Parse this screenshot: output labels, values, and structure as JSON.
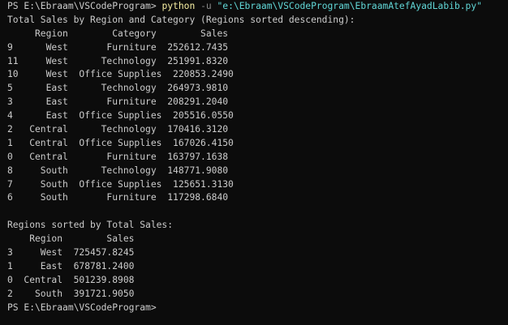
{
  "terminal": {
    "prompt_path": "PS E:\\Ebraam\\VSCodeProgram> ",
    "command": {
      "program": "python",
      "flag": "-u",
      "argument": "\"e:\\Ebraam\\VSCodeProgram\\EbraamAtefAyadLabib.py\""
    },
    "colors": {
      "background": "#0c0c0c",
      "text": "#cccccc",
      "command": "#f9f1a5",
      "flag": "#8a8a8a",
      "string": "#61d6d6"
    }
  },
  "output1": {
    "title": "Total Sales by Region and Category (Regions sorted descending):",
    "header": "     Region        Category        Sales",
    "rows": [
      "9      West       Furniture  252612.7435",
      "11     West      Technology  251991.8320",
      "10     West  Office Supplies  220853.2490",
      "5      East      Technology  264973.9810",
      "3      East       Furniture  208291.2040",
      "4      East  Office Supplies  205516.0550",
      "2   Central      Technology  170416.3120",
      "1   Central  Office Supplies  167026.4150",
      "0   Central       Furniture  163797.1638",
      "8     South      Technology  148771.9080",
      "7     South  Office Supplies  125651.3130",
      "6     South       Furniture  117298.6840"
    ]
  },
  "output2": {
    "title": "Regions sorted by Total Sales:",
    "header": "    Region        Sales",
    "rows": [
      "3     West  725457.8245",
      "1     East  678781.2400",
      "0  Central  501239.8908",
      "2    South  391721.9050"
    ]
  },
  "final_prompt": "PS E:\\Ebraam\\VSCodeProgram>"
}
